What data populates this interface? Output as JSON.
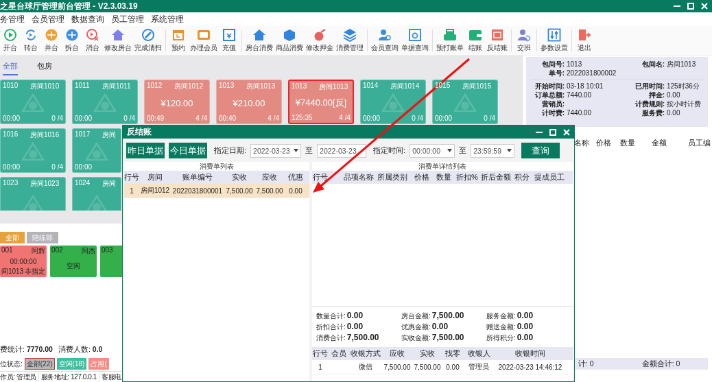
{
  "window": {
    "title": "之星台球厅管理前台管理 - V2.3.03.19"
  },
  "menu": [
    "务管理",
    "会员管理",
    "数据查询",
    "员工管理",
    "系统管理"
  ],
  "toolbar": [
    [
      {
        "label": "开台"
      },
      {
        "label": "转台"
      },
      {
        "label": "并台"
      },
      {
        "label": "拆台"
      },
      {
        "label": "消台"
      },
      {
        "label": "修改房台"
      },
      {
        "label": "完成清扫"
      }
    ],
    [
      {
        "label": "预约"
      },
      {
        "label": "办理会员"
      },
      {
        "label": "充值"
      }
    ],
    [
      {
        "label": "房台消费"
      },
      {
        "label": "商品消费"
      },
      {
        "label": "修改押金"
      },
      {
        "label": "消费管理"
      }
    ],
    [
      {
        "label": "会员查询"
      },
      {
        "label": "单据查询"
      }
    ],
    [
      {
        "label": "预打账单"
      },
      {
        "label": "结账"
      },
      {
        "label": "反结账"
      }
    ],
    [
      {
        "label": "交班"
      }
    ],
    [
      {
        "label": "参数设置"
      }
    ],
    [
      {
        "label": "退出"
      }
    ]
  ],
  "room_tabs": [
    {
      "label": "全部",
      "selected": true
    },
    {
      "label": "包房",
      "selected": false
    }
  ],
  "rooms": [
    [
      {
        "number": "1010",
        "name": "房间1010",
        "time": "00:00",
        "count": "0 /4",
        "kind": "free",
        "selected": false
      },
      {
        "number": "1011",
        "name": "房间1011",
        "time": "00:00",
        "count": "0 /4",
        "kind": "free",
        "selected": false
      },
      {
        "number": "1012",
        "name": "房间1012",
        "amount": "¥120.00",
        "time": "00:49",
        "count": "4 /4",
        "kind": "busy",
        "selected": false
      },
      {
        "number": "1013",
        "name": "房间1013",
        "amount": "¥210.00",
        "time": "00:40",
        "count": "4 /4",
        "kind": "busy",
        "selected": false
      },
      {
        "number": "1013",
        "name": "房间1013",
        "amount": "¥7440.00[反]",
        "time": "125:35",
        "count": "4 /4",
        "kind": "busy",
        "selected": true
      },
      {
        "number": "1014",
        "name": "房间1014",
        "time": "00:00",
        "count": "0 /4",
        "kind": "free",
        "selected": false
      },
      {
        "number": "1015",
        "name": "房间1015",
        "time": "00:00",
        "count": "0 /4",
        "kind": "free",
        "selected": false
      }
    ],
    [
      {
        "number": "1016",
        "name": "房间1016",
        "time": "00:00",
        "count": "0 /4",
        "kind": "free",
        "selected": false
      },
      {
        "number": "1017",
        "name": "房间",
        "time": "00:00",
        "kind": "free",
        "selected": false
      }
    ],
    [
      {
        "number": "1023",
        "name": "房间1023",
        "kind": "free",
        "selected": false
      },
      {
        "number": "1024",
        "name": "房间",
        "kind": "free",
        "selected": false
      }
    ]
  ],
  "room_info": {
    "header": [
      [
        {
          "label": "包间号:",
          "value": "1013"
        },
        {
          "label": "包间名:",
          "value": "房间1013"
        }
      ],
      [
        {
          "label": "单号:",
          "value": "2022031800002"
        }
      ]
    ],
    "details": [
      [
        {
          "label": "开始时间:",
          "value": "03-18 10:01"
        },
        {
          "label": "已用时间:",
          "value": "125时36分"
        }
      ],
      [
        {
          "label": "订单总额:",
          "value": "7440.00"
        },
        {
          "label": "押金:",
          "value": "0.00"
        }
      ],
      [
        {
          "label": "营销员:"
        },
        {
          "label": "计费规则:",
          "value": "按小时计费"
        }
      ],
      [
        {
          "label": "计时费:",
          "value": "7440.00"
        },
        {
          "label": "服务费:",
          "value": "0.00"
        }
      ]
    ]
  },
  "goods_table": {
    "columns": [
      "名称",
      "价格",
      "数量",
      "金额",
      "员工编"
    ]
  },
  "goods_footer": [
    "计: 0",
    "金额合计: 0"
  ],
  "staff_groups": [
    {
      "label": "全部",
      "selected": true
    },
    {
      "label": "陪练部",
      "selected": false
    }
  ],
  "staff": [
    {
      "number": "001",
      "name": "阿辉",
      "time": "00:00:00",
      "room": "间1013",
      "note": "非指定",
      "kind": "busy"
    },
    {
      "number": "002",
      "name": "阿杰",
      "state": "空闲",
      "kind": "free"
    },
    {
      "number": "003",
      "kind": "free"
    }
  ],
  "stats": [
    {
      "label": "费统计:",
      "value": "7770.00"
    },
    {
      "label": "消费人数:",
      "value": "0.0"
    }
  ],
  "seat_status": {
    "label": "位状态:",
    "filters": [
      {
        "label": "全部(22)",
        "selected": true,
        "color": "#b8b8bc"
      },
      {
        "label": "空闲(18)",
        "selected": false,
        "color": "#3ebf9f"
      },
      {
        "label": "占用(",
        "selected": false,
        "color": "#f48d86"
      }
    ]
  },
  "status_bar": [
    "作员: 管理员",
    "服务地址: 127.0.0.1",
    "客服电"
  ],
  "dialog": {
    "title": "反结账",
    "quick_buttons": [
      "昨日单据",
      "今日单据"
    ],
    "date_range": {
      "label": "指定日期:",
      "from": "2022-03-23",
      "sep": "至",
      "to": "2022-03-23"
    },
    "time_range": {
      "label": "指定时间:",
      "from": "00:00:00",
      "sep": "至",
      "to": "23:59:59"
    },
    "query": "查询",
    "bill_list": {
      "caption": "消费单列表",
      "columns": [
        "行号",
        "房间",
        "账单编号",
        "实收",
        "应收",
        "优惠"
      ],
      "rows": [
        {
          "cells": [
            "1",
            "房间1012",
            "2022031800001",
            "7,500.00",
            "7,500.00",
            "0.00"
          ],
          "selected": true
        }
      ]
    },
    "detail_list": {
      "caption": "消费单详情列表",
      "columns": [
        "行号",
        "品项名称",
        "所属类别",
        "价格",
        "数量",
        "折扣%",
        "折后金额",
        "积分",
        "提成员工"
      ]
    },
    "summary": [
      [
        {
          "label": "数量合计:",
          "value": "0.00"
        },
        {
          "label": "折扣合计:",
          "value": "0.00"
        },
        {
          "label": "消费合计:",
          "value": "7,500.00"
        }
      ],
      [
        {
          "label": "房台金额:",
          "value": "7,500.00"
        },
        {
          "label": "优惠金额:",
          "value": "0.00"
        },
        {
          "label": "实收金额:",
          "value": "7,500.00"
        }
      ],
      [
        {
          "label": "服务金额:",
          "value": "0.00"
        },
        {
          "label": "赠送金额:",
          "value": "0.00"
        },
        {
          "label": "所得积分:",
          "value": "0.00"
        }
      ]
    ],
    "payments": {
      "columns": [
        "行号",
        "会员",
        "收银方式",
        "应收",
        "实收",
        "找零",
        "收银人",
        "收银时间"
      ],
      "rows": [
        [
          "1",
          null,
          "微信",
          "7,500.00",
          "7,500.00",
          "0.00",
          "管理员",
          "2022-03-23 14:46:12"
        ]
      ]
    }
  }
}
